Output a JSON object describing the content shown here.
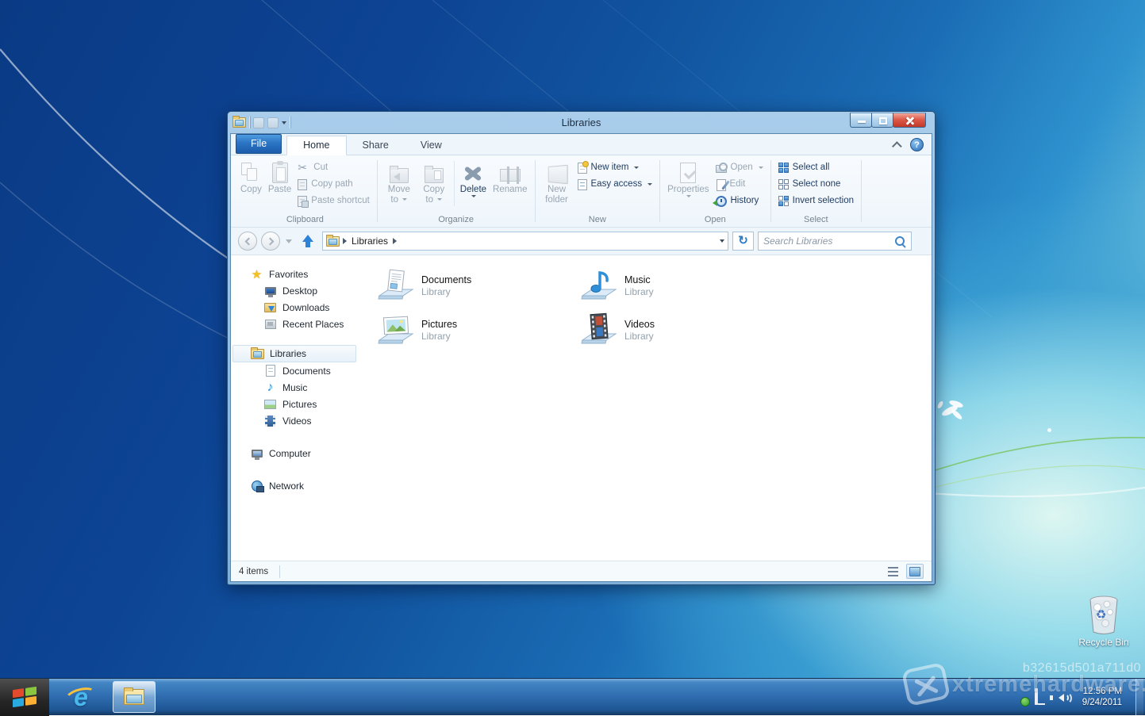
{
  "window": {
    "title": "Libraries",
    "tabs": {
      "file": "File",
      "home": "Home",
      "share": "Share",
      "view": "View"
    },
    "ribbon": {
      "clipboard": {
        "label": "Clipboard",
        "copy": "Copy",
        "paste": "Paste",
        "cut": "Cut",
        "copy_path": "Copy path",
        "paste_shortcut": "Paste shortcut"
      },
      "organize": {
        "label": "Organize",
        "move_to": "Move to",
        "copy_to": "Copy to",
        "delete": "Delete",
        "rename": "Rename"
      },
      "new_group": {
        "label": "New",
        "new_folder": "New folder",
        "new_item": "New item",
        "easy_access": "Easy access"
      },
      "open_group": {
        "label": "Open",
        "properties": "Properties",
        "open": "Open",
        "edit": "Edit",
        "history": "History"
      },
      "select_group": {
        "label": "Select",
        "select_all": "Select all",
        "select_none": "Select none",
        "invert_selection": "Invert selection"
      }
    },
    "address": {
      "location": "Libraries",
      "search_placeholder": "Search Libraries"
    },
    "sidebar": {
      "items": [
        {
          "label": "Favorites"
        },
        {
          "label": "Desktop"
        },
        {
          "label": "Downloads"
        },
        {
          "label": "Recent Places"
        },
        {
          "label": "Libraries"
        },
        {
          "label": "Documents"
        },
        {
          "label": "Music"
        },
        {
          "label": "Pictures"
        },
        {
          "label": "Videos"
        },
        {
          "label": "Computer"
        },
        {
          "label": "Network"
        }
      ]
    },
    "content": {
      "items": [
        {
          "name": "Documents",
          "type": "Library"
        },
        {
          "name": "Music",
          "type": "Library"
        },
        {
          "name": "Pictures",
          "type": "Library"
        },
        {
          "name": "Videos",
          "type": "Library"
        }
      ]
    },
    "statusbar": {
      "item_count": "4 items"
    }
  },
  "desktop": {
    "recycle_bin_label": "Recycle Bin",
    "watermark_build": "b32615d501a711d0",
    "watermark_site": "xtremehardware.it"
  },
  "taskbar": {
    "clock_time": "12:56 PM",
    "clock_date": "9/24/2011"
  },
  "icons": {
    "search": "magnifier",
    "refresh": "circular-arrow",
    "help": "?",
    "dropdown": "caret-down",
    "breadcrumb_separator": "caret-right",
    "cut": "scissors",
    "music": "eighth-note",
    "favorites": "star"
  },
  "colors": {
    "titlebar_glass": "#9cc3e8",
    "file_tab_blue": "#2b74c4",
    "close_button_red": "#d9493a",
    "taskbar_blue": "#2f6db0",
    "desktop_deep_blue": "#0d4494",
    "selection_highlight": "#e7f1f9",
    "enabled_text": "#1e3a5f",
    "disabled_text": "#9aa7b3"
  }
}
